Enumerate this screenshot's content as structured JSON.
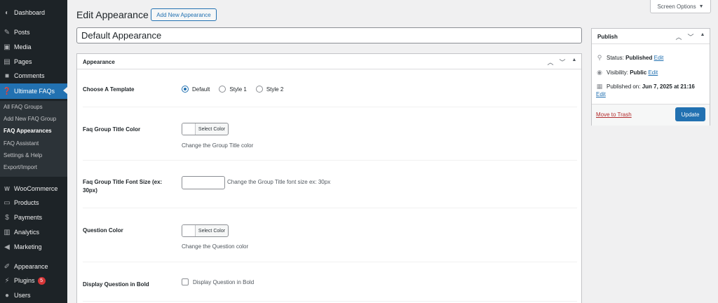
{
  "sidebar": {
    "items": [
      {
        "label": "Dashboard",
        "icon": "dashboard-icon"
      },
      {
        "label": "Posts",
        "icon": "pin-icon"
      },
      {
        "label": "Media",
        "icon": "media-icon"
      },
      {
        "label": "Pages",
        "icon": "pages-icon"
      },
      {
        "label": "Comments",
        "icon": "comment-icon"
      },
      {
        "label": "Ultimate FAQs",
        "icon": "question-icon"
      },
      {
        "label": "WooCommerce",
        "icon": "woo-icon"
      },
      {
        "label": "Products",
        "icon": "archive-icon"
      },
      {
        "label": "Payments",
        "icon": "dollar-icon"
      },
      {
        "label": "Analytics",
        "icon": "bar-chart-icon"
      },
      {
        "label": "Marketing",
        "icon": "megaphone-icon"
      },
      {
        "label": "Appearance",
        "icon": "brush-icon"
      },
      {
        "label": "Plugins",
        "icon": "plugin-icon",
        "badge": "5"
      },
      {
        "label": "Users",
        "icon": "user-icon"
      }
    ],
    "submenu": [
      "All FAQ Groups",
      "Add New FAQ Group",
      "FAQ Appearances",
      "FAQ Assistant",
      "Settings & Help",
      "Export/Import"
    ]
  },
  "header": {
    "title": "Edit Appearance",
    "add_new": "Add New Appearance",
    "screen_options": "Screen Options"
  },
  "post_title": "Default Appearance",
  "appearance": {
    "title": "Appearance",
    "template_label": "Choose A Template",
    "template_options": [
      "Default",
      "Style 1",
      "Style 2"
    ],
    "template_selected": "Default",
    "group_title_color_label": "Faq Group Title Color",
    "select_color": "Select Color",
    "group_title_color_hint": "Change the Group Title color",
    "font_size_label": "Faq Group Title Font Size (ex: 30px)",
    "font_size_hint": "Change the Group Title font size ex: 30px",
    "question_color_label": "Question Color",
    "question_color_hint": "Change the Question color",
    "bold_label": "Display Question in Bold",
    "bold_checkbox": "Display Question in Bold"
  },
  "publish": {
    "title": "Publish",
    "status_label": "Status:",
    "status_value": "Published",
    "visibility_label": "Visibility:",
    "visibility_value": "Public",
    "published_label": "Published on:",
    "published_value": "Jun 7, 2025 at 21:16",
    "edit": "Edit",
    "trash": "Move to Trash",
    "update": "Update"
  },
  "colors": {
    "sidebar_bg": "#1d2327",
    "accent": "#2271b1",
    "danger": "#b32d2e"
  }
}
